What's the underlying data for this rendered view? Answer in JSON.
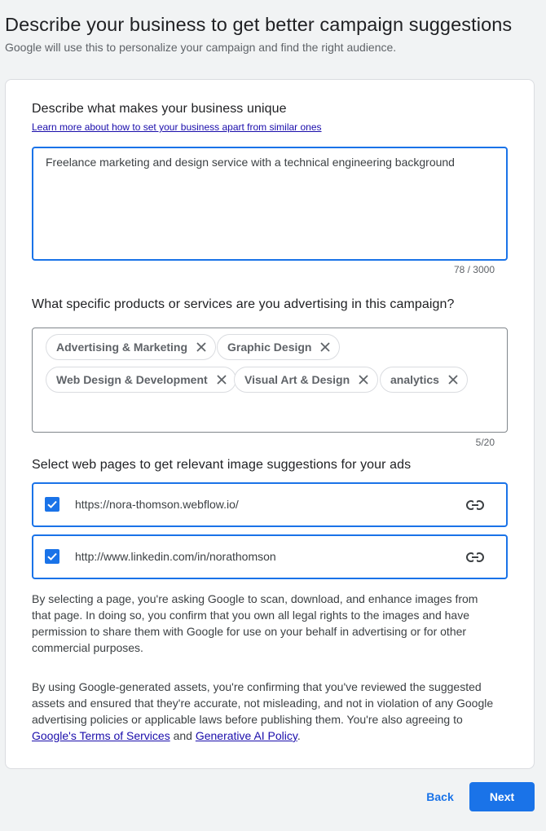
{
  "header": {
    "title": "Describe your business to get better campaign suggestions",
    "subtitle": "Google will use this to personalize your campaign and find the right audience."
  },
  "unique": {
    "heading": "Describe what makes your business unique",
    "learn_more": "Learn more about how to set your business apart from similar ones",
    "value": "Freelance marketing and design service with a technical engineering background",
    "counter": "78 / 3000"
  },
  "products": {
    "heading": "What specific products or services are you advertising in this campaign?",
    "chips": [
      {
        "label": "Advertising & Marketing"
      },
      {
        "label": "Graphic Design"
      },
      {
        "label": "Web Design & Development"
      },
      {
        "label": "Visual Art & Design"
      },
      {
        "label": "analytics"
      }
    ],
    "counter": "5/20"
  },
  "pages": {
    "heading": "Select web pages to get relevant image suggestions for your ads",
    "items": [
      {
        "url": "https://nora-thomson.webflow.io/",
        "checked": true
      },
      {
        "url": "http://www.linkedin.com/in/norathomson",
        "checked": true
      }
    ]
  },
  "consent": {
    "para1": "By selecting a page, you're asking Google to scan, download, and enhance images from that page. In doing so, you confirm that you own all legal rights to the images and have permission to share them with Google for use on your behalf in advertising or for other commercial purposes.",
    "para2_prefix": "By using Google-generated assets, you're confirming that you've reviewed the suggested assets and ensured that they're accurate, not misleading, and not in violation of any Google advertising policies or applicable laws before publishing them. You're also agreeing to ",
    "terms_link": "Google's Terms of Services",
    "and_text": " and ",
    "ai_policy_link": "Generative AI Policy",
    "period": "."
  },
  "footer": {
    "back_label": "Back",
    "next_label": "Next"
  },
  "colors": {
    "accent": "#1a73e8",
    "link": "#1a0dab"
  },
  "icons": {
    "chip_remove": "close-icon",
    "checkbox": "check-icon",
    "page_link": "link-icon"
  }
}
